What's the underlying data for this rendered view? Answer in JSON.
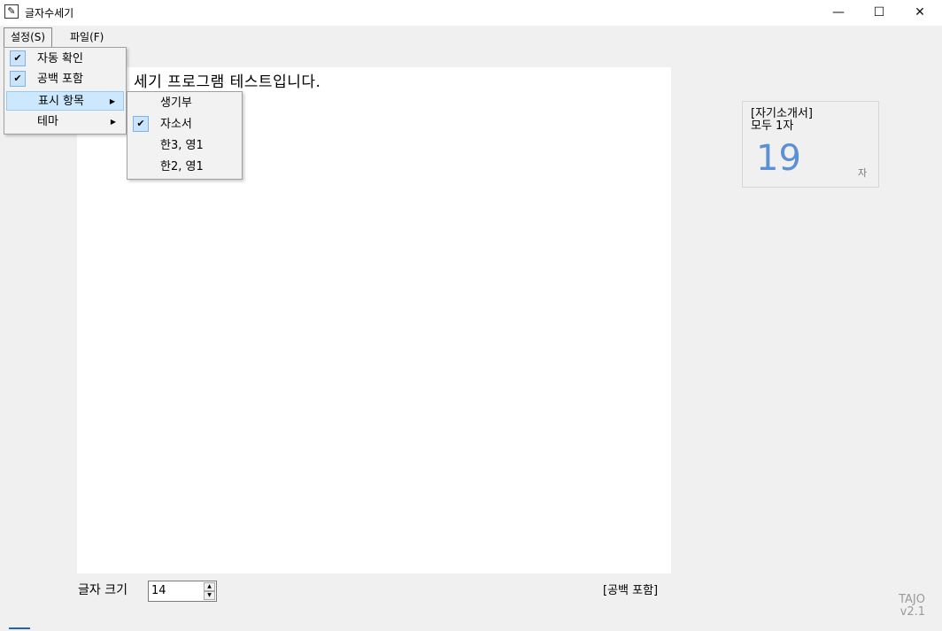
{
  "window": {
    "title": "글자수세기",
    "min_icon": "minimize-icon",
    "max_icon": "maximize-icon",
    "close_icon": "close-icon"
  },
  "menubar": {
    "settings": "설정(S)",
    "file": "파일(F)"
  },
  "settings_menu": {
    "items": [
      {
        "label": "자동 확인",
        "checked": true
      },
      {
        "label": "공백 포함",
        "checked": true
      },
      {
        "label": "표시 항목",
        "has_submenu": true,
        "highlighted": true
      },
      {
        "label": "테마",
        "has_submenu": true
      }
    ]
  },
  "display_submenu": {
    "items": [
      {
        "label": "생기부",
        "checked": false
      },
      {
        "label": "자소서",
        "checked": true
      },
      {
        "label": "한3, 영1",
        "checked": false
      },
      {
        "label": "한2, 영1",
        "checked": false
      }
    ]
  },
  "editor": {
    "text": "세기 프로그램 테스트입니다."
  },
  "stats": {
    "category": "[자기소개서]",
    "subtitle": "모두 1자",
    "count": "19",
    "unit": "자",
    "count_color": "#5b8fd6"
  },
  "footer": {
    "font_size_label": "글자 크기",
    "font_size_value": "14",
    "space_status": "[공백 포함]"
  },
  "brand": {
    "name": "TAJO",
    "version": "v2.1"
  }
}
